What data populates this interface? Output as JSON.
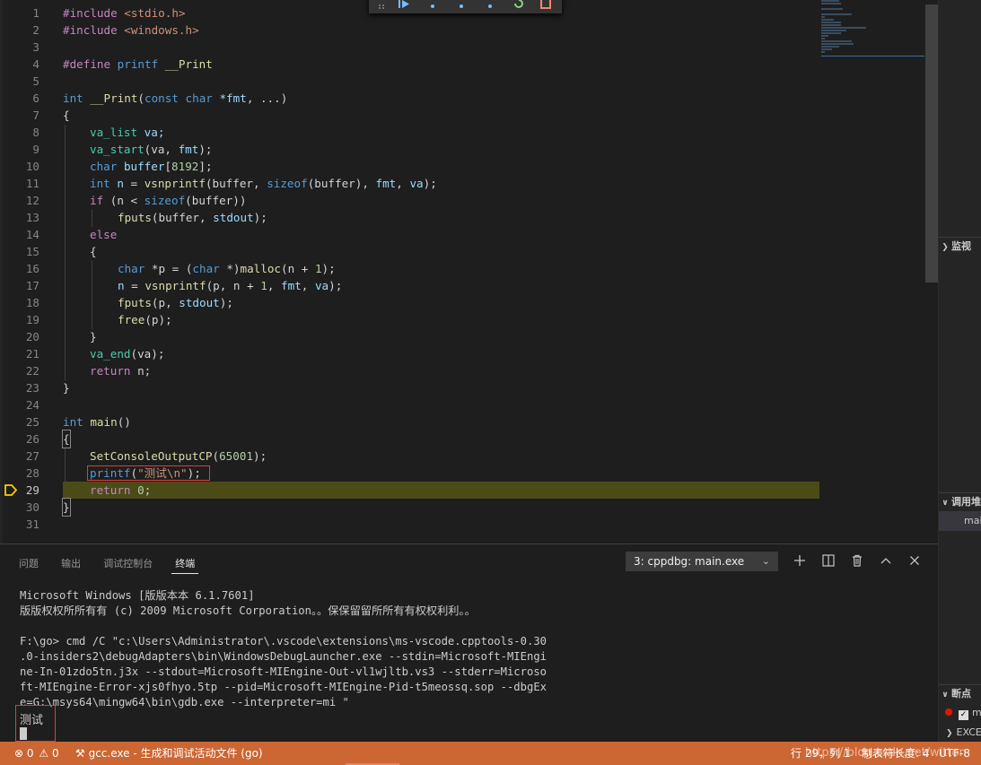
{
  "editor": {
    "lines": [
      {
        "n": "1"
      },
      {
        "n": "2"
      },
      {
        "n": "3"
      },
      {
        "n": "4"
      },
      {
        "n": "5"
      },
      {
        "n": "6"
      },
      {
        "n": "7"
      },
      {
        "n": "8"
      },
      {
        "n": "9"
      },
      {
        "n": "10"
      },
      {
        "n": "11"
      },
      {
        "n": "12"
      },
      {
        "n": "13"
      },
      {
        "n": "14"
      },
      {
        "n": "15"
      },
      {
        "n": "16"
      },
      {
        "n": "17"
      },
      {
        "n": "18"
      },
      {
        "n": "19"
      },
      {
        "n": "20"
      },
      {
        "n": "21"
      },
      {
        "n": "22"
      },
      {
        "n": "23"
      },
      {
        "n": "24"
      },
      {
        "n": "25"
      },
      {
        "n": "26"
      },
      {
        "n": "27"
      },
      {
        "n": "28"
      },
      {
        "n": "29"
      },
      {
        "n": "30"
      },
      {
        "n": "31"
      }
    ],
    "code": {
      "l1a": "#include",
      "l1b": "<stdio.h>",
      "l2a": "#include",
      "l2b": "<windows.h>",
      "l4a": "#define",
      "l4b": "printf",
      "l4c": "__Print",
      "l6": [
        "int",
        "__Print",
        "(",
        "const",
        "char",
        "*fmt",
        ", ...)"
      ],
      "l7": "{",
      "l8": [
        "va_list",
        "va;"
      ],
      "l9": [
        "va_start",
        "(va, ",
        "fmt",
        ");"
      ],
      "l10": [
        "char",
        "buffer",
        "[",
        "8192",
        "];"
      ],
      "l11": [
        "int",
        "n",
        " = ",
        "vsnprintf",
        "(buffer, ",
        "sizeof",
        "(buffer), ",
        "fmt",
        ", ",
        "va",
        ");"
      ],
      "l12": [
        "if",
        " (n < ",
        "sizeof",
        "(buffer))"
      ],
      "l13": [
        "fputs",
        "(buffer, ",
        "stdout",
        ");"
      ],
      "l14": "else",
      "l15": "{",
      "l16": [
        "char",
        " *p = (",
        "char",
        " *)",
        "malloc",
        "(n + ",
        "1",
        ");"
      ],
      "l17": [
        "n",
        " = ",
        "vsnprintf",
        "(p, n + ",
        "1",
        ", ",
        "fmt",
        ", ",
        "va",
        ");"
      ],
      "l18": [
        "fputs",
        "(p, ",
        "stdout",
        ");"
      ],
      "l19": [
        "free",
        "(p);"
      ],
      "l20": "}",
      "l21": [
        "va_end",
        "(va);"
      ],
      "l22": [
        "return",
        " n;"
      ],
      "l23": "}",
      "l25": [
        "int",
        "main",
        "()"
      ],
      "l26": "{",
      "l27": [
        "SetConsoleOutputCP",
        "(",
        "65001",
        ");"
      ],
      "l28": [
        "printf",
        "(",
        "\"测试\\n\"",
        ");"
      ],
      "l29": [
        "return",
        "0",
        ";"
      ],
      "l30": "}"
    }
  },
  "side": {
    "watch_label": "监视",
    "callstack_label": "调用堆",
    "callstack_item": "mai",
    "breakpoints_label": "断点",
    "breakpoint_item": "m",
    "exceptions_item": "EXCEP"
  },
  "panel": {
    "tabs": [
      "问题",
      "输出",
      "调试控制台",
      "终端"
    ],
    "terminal_select": "3: cppdbg: main.exe",
    "terminal_lines": [
      "Microsoft Windows [版版本本 6.1.7601]",
      "版版权权所所有有 (c) 2009 Microsoft Corporation。。保保留留所所有有权权利利。。",
      "",
      "F:\\go> cmd /C \"c:\\Users\\Administrator\\.vscode\\extensions\\ms-vscode.cpptools-0.30",
      ".0-insiders2\\debugAdapters\\bin\\WindowsDebugLauncher.exe --stdin=Microsoft-MIEngi",
      "ne-In-01zdo5tn.j3x --stdout=Microsoft-MIEngine-Out-vl1wjltb.vs3 --stderr=Microso",
      "ft-MIEngine-Error-xjs0fhyo.5tp --pid=Microsoft-MIEngine-Pid-t5meossq.sop --dbgEx",
      "e=G:\\msys64\\mingw64\\bin\\gdb.exe --interpreter=mi \""
    ],
    "output_text": "测试"
  },
  "status": {
    "errors": "0",
    "warnings": "0",
    "task": "gcc.exe - 生成和调试活动文件 (go)",
    "position": "行 29，列 1",
    "tab_size": "制表符长度: 4",
    "encoding": "UTF-8",
    "watermark": "https://blog.csdn.net/witton"
  },
  "colors": {
    "statusbar": "#cc6633",
    "current_line_highlight": "#4b4b18",
    "breakpoint_arrow": "#ffcc00",
    "annotation_box": "#e03c3c"
  }
}
